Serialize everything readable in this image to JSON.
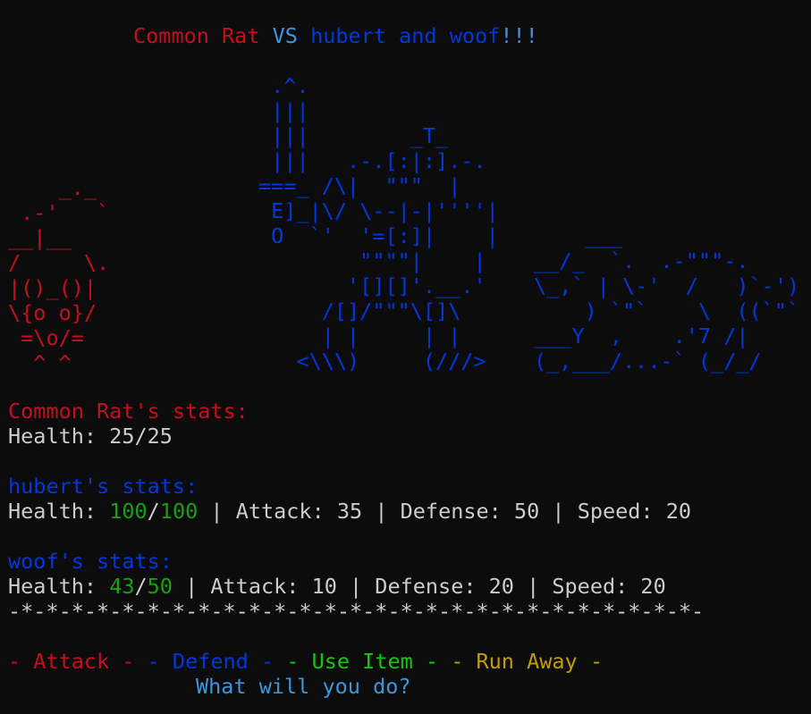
{
  "title": {
    "enemy": "Common Rat",
    "vs": "VS",
    "party": "hubert and woof",
    "bang": "!!!"
  },
  "art": {
    "rat": "    _._\n .-'   `\n__|__\n/     \\.\n|()_()|\n\\{o o}/\n =\\o/=\n  ^ ^",
    "knight": " .^.\n |||\n |||        _T_\n |||   .-.[:|:].-.\n===_ /\\|  \"\"\"  |\n E]_|\\/ \\--|-|''''|\n O  `'  '=[:]|    |\n        \"\"\"\"|    |\n       '[][]'.__.'\n     /[]/\"\"\"\\[]\\\n     | |     | |\n   <\\\\\\)     (///>",
    "dog": "    ___\n__/_  `.  .-\"\"\"-.\n\\_,` | \\-'  /   )`-')\n    ) `\"`    \\  ((`\"`\n___Y  ,    .'7 /|\n(_,___/...-` (_/_/"
  },
  "enemy_stats": {
    "header": "Common Rat's stats:",
    "health_label": "Health: ",
    "health": "25/25"
  },
  "hubert_stats": {
    "header": "hubert's stats:",
    "health_label": "Health: ",
    "health_cur": "100",
    "slash": "/",
    "health_max": "100",
    "rest": " | Attack: 35 | Defense: 50 | Speed: 20"
  },
  "woof_stats": {
    "header": "woof's stats:",
    "health_label": "Health: ",
    "health_cur": "43",
    "slash": "/",
    "health_max": "50",
    "rest": " | Attack: 10 | Defense: 20 | Speed: 20"
  },
  "divider": "-*-*-*-*-*-*-*-*-*-*-*-*-*-*-*-*-*-*-*-*-*-*-*-*-*-*-*-",
  "menu": {
    "attack": "- Attack -",
    "defend": "- Defend -",
    "use_item": "- Use Item -",
    "run_away": "- Run Away -"
  },
  "prompt": "What will you do?",
  "colors": {
    "background": "#0c0c0c",
    "enemy": "#c50f1f",
    "party": "#0037da",
    "accent": "#3a96dd",
    "health": "#13a10e",
    "item": "#16c60c",
    "run": "#c19c00",
    "text": "#cccccc"
  }
}
